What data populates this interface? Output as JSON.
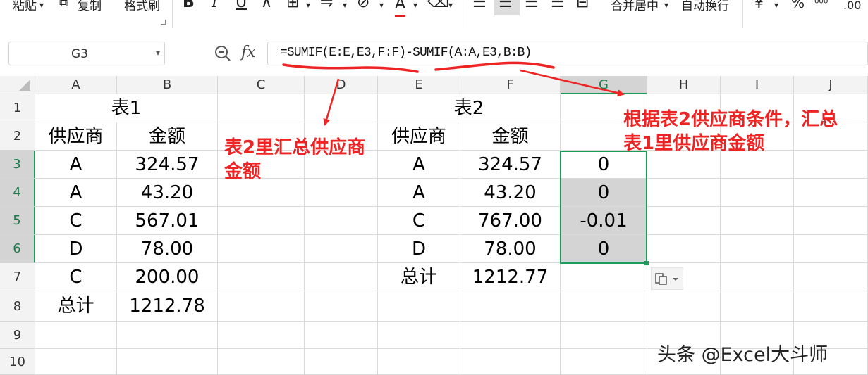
{
  "ribbon": {
    "paste_label": "粘贴",
    "copy_label": "复制",
    "format_painter_label": "格式刷",
    "bold_label": "B",
    "italic_label": "I",
    "underline_label": "U",
    "font_color_label": "A",
    "merge_center_label": "合并居中",
    "wrap_text_label": "自动换行",
    "currency_label": "¥",
    "percent_label": "%",
    "decimal_label": ".00"
  },
  "formula_bar": {
    "name_box": "G3",
    "fx_label": "fx",
    "formula": "=SUMIF(E:E,E3,F:F)-SUMIF(A:A,E3,B:B)"
  },
  "columns": [
    "A",
    "B",
    "C",
    "D",
    "E",
    "F",
    "G",
    "H",
    "I",
    "J"
  ],
  "rows": [
    "1",
    "2",
    "3",
    "4",
    "5",
    "6",
    "7",
    "8",
    "9",
    "10"
  ],
  "table1": {
    "title": "表1",
    "headers": [
      "供应商",
      "金额"
    ],
    "rows": [
      [
        "A",
        "324.57"
      ],
      [
        "A",
        "43.20"
      ],
      [
        "C",
        "567.01"
      ],
      [
        "D",
        "78.00"
      ],
      [
        "C",
        "200.00"
      ]
    ],
    "total_label": "总计",
    "total_value": "1212.78"
  },
  "table2": {
    "title": "表2",
    "headers": [
      "供应商",
      "金额"
    ],
    "rows": [
      [
        "A",
        "324.57"
      ],
      [
        "A",
        "43.20"
      ],
      [
        "C",
        "767.00"
      ],
      [
        "D",
        "78.00"
      ]
    ],
    "total_label": "总计",
    "total_value": "1212.77"
  },
  "results": [
    "0",
    "0",
    "-0.01",
    "0"
  ],
  "annotations": {
    "left_note": [
      "表2里汇总供应商",
      "金额"
    ],
    "right_note": [
      "根据表2供应商条件，汇总",
      "表1里供应商金额"
    ]
  },
  "watermark": "头条 @Excel大斗师",
  "colors": {
    "annotation": "#ee2424",
    "selection": "#1f9a5d",
    "selected_fill": "#d4d4d4"
  }
}
